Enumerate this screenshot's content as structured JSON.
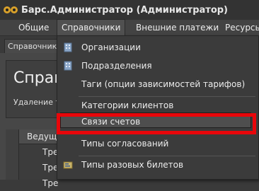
{
  "window": {
    "title": "Барс.Администратор (Администратор)"
  },
  "menubar": {
    "items": [
      {
        "label": "Общие"
      },
      {
        "label": "Справочники"
      },
      {
        "label": "Внешние платежи"
      },
      {
        "label": "Ресурсы"
      }
    ]
  },
  "tabs": [
    {
      "label": "Справочник"
    }
  ],
  "panel": {
    "title": "Справо",
    "subtitle": "Удаление т"
  },
  "grid": {
    "column_header": "Ведуща",
    "rows": [
      {
        "cell": "Тре"
      },
      {
        "cell": "Тре"
      },
      {
        "cell": "Тре"
      }
    ]
  },
  "dropdown": {
    "items": [
      {
        "label": "Организации",
        "icon": "building-icon"
      },
      {
        "label": "Подразделения",
        "icon": "building-icon"
      },
      {
        "label": "Таги (опции зависимостей тарифов)",
        "icon": ""
      },
      {
        "label": "Категории клиентов",
        "icon": ""
      },
      {
        "label": "Связи счетов",
        "icon": ""
      },
      {
        "label": "Типы согласований",
        "icon": ""
      },
      {
        "label": "Типы разовых билетов",
        "icon": "ticket-icon"
      }
    ]
  },
  "colors": {
    "highlight_frame": "#e8060a",
    "background": "#3a3a3a",
    "menu": "#3b3b3b"
  }
}
